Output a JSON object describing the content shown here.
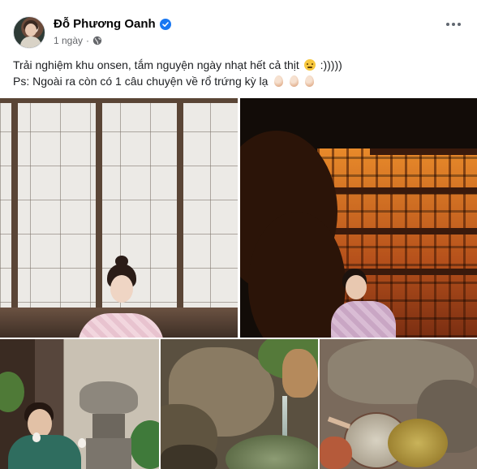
{
  "post": {
    "author": "Đỗ Phương Oanh",
    "time": "1 ngày",
    "separator": "·",
    "text_line1": "Trải nghiệm khu onsen, tắm nguyện ngày nhạt hết cả thịt",
    "text_line1_tail": ":)))))",
    "text_line2": "Ps: Ngoài ra còn có 1 câu chuyện về rổ trứng kỳ lạ",
    "emojis": [
      "crying-face-emoji",
      "egg-emoji",
      "egg-emoji",
      "egg-emoji"
    ],
    "privacy_icon": "globe-icon",
    "verified_icon": "verified-badge-icon",
    "more_icon": "more-options-icon"
  },
  "colors": {
    "verified": "#1877f2",
    "meta": "#65676b",
    "text": "#1c1e21"
  },
  "photos": [
    {
      "name": "photo-kimono-shoji-room"
    },
    {
      "name": "photo-night-temple"
    },
    {
      "name": "photo-eggs-stone-lantern"
    },
    {
      "name": "photo-stone-water-fountain"
    },
    {
      "name": "photo-egg-basket-hot-spring"
    }
  ]
}
